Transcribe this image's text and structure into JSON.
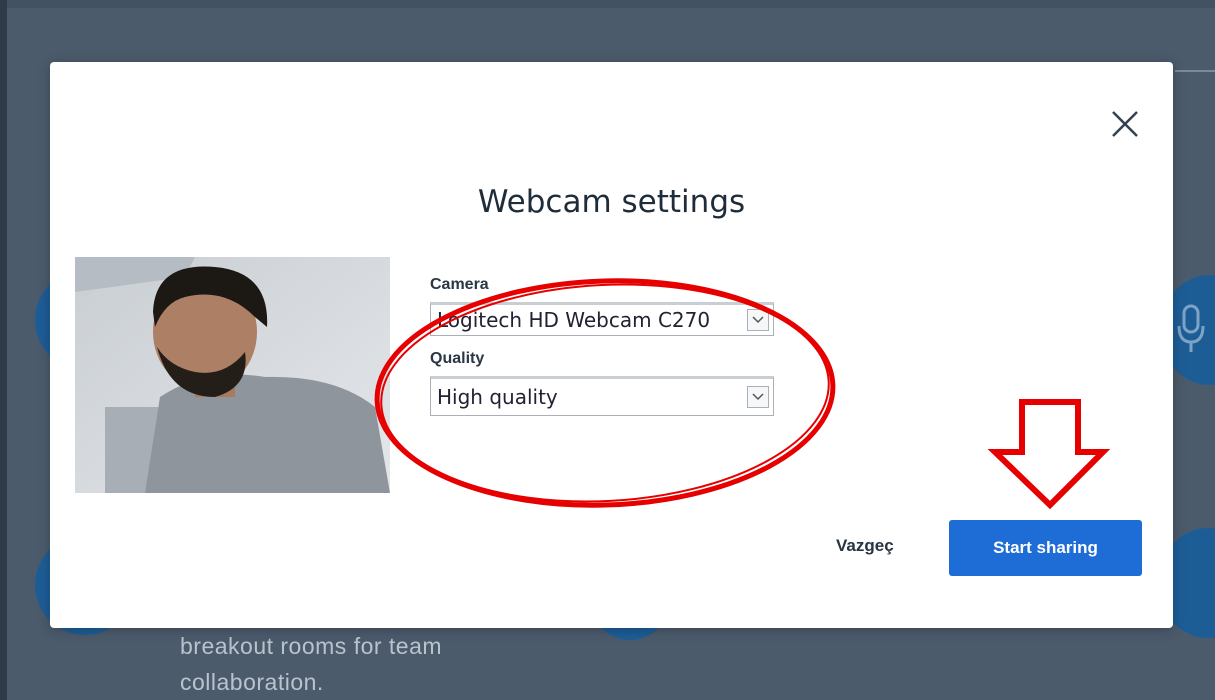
{
  "background": {
    "caption_line1": "breakout rooms for team",
    "caption_line2": "collaboration."
  },
  "dialog": {
    "title": "Webcam settings",
    "camera_label": "Camera",
    "camera_value": "Logitech HD Webcam C270",
    "quality_label": "Quality",
    "quality_value": "High quality",
    "cancel_label": "Vazgeç",
    "start_label": "Start sharing"
  },
  "colors": {
    "primary": "#1e6dd6",
    "annotation": "#e60000",
    "overlay": "#4b5b6c"
  },
  "icons": {
    "close": "close-icon",
    "dropdown": "chevron-down-icon",
    "microphone": "microphone-icon"
  }
}
